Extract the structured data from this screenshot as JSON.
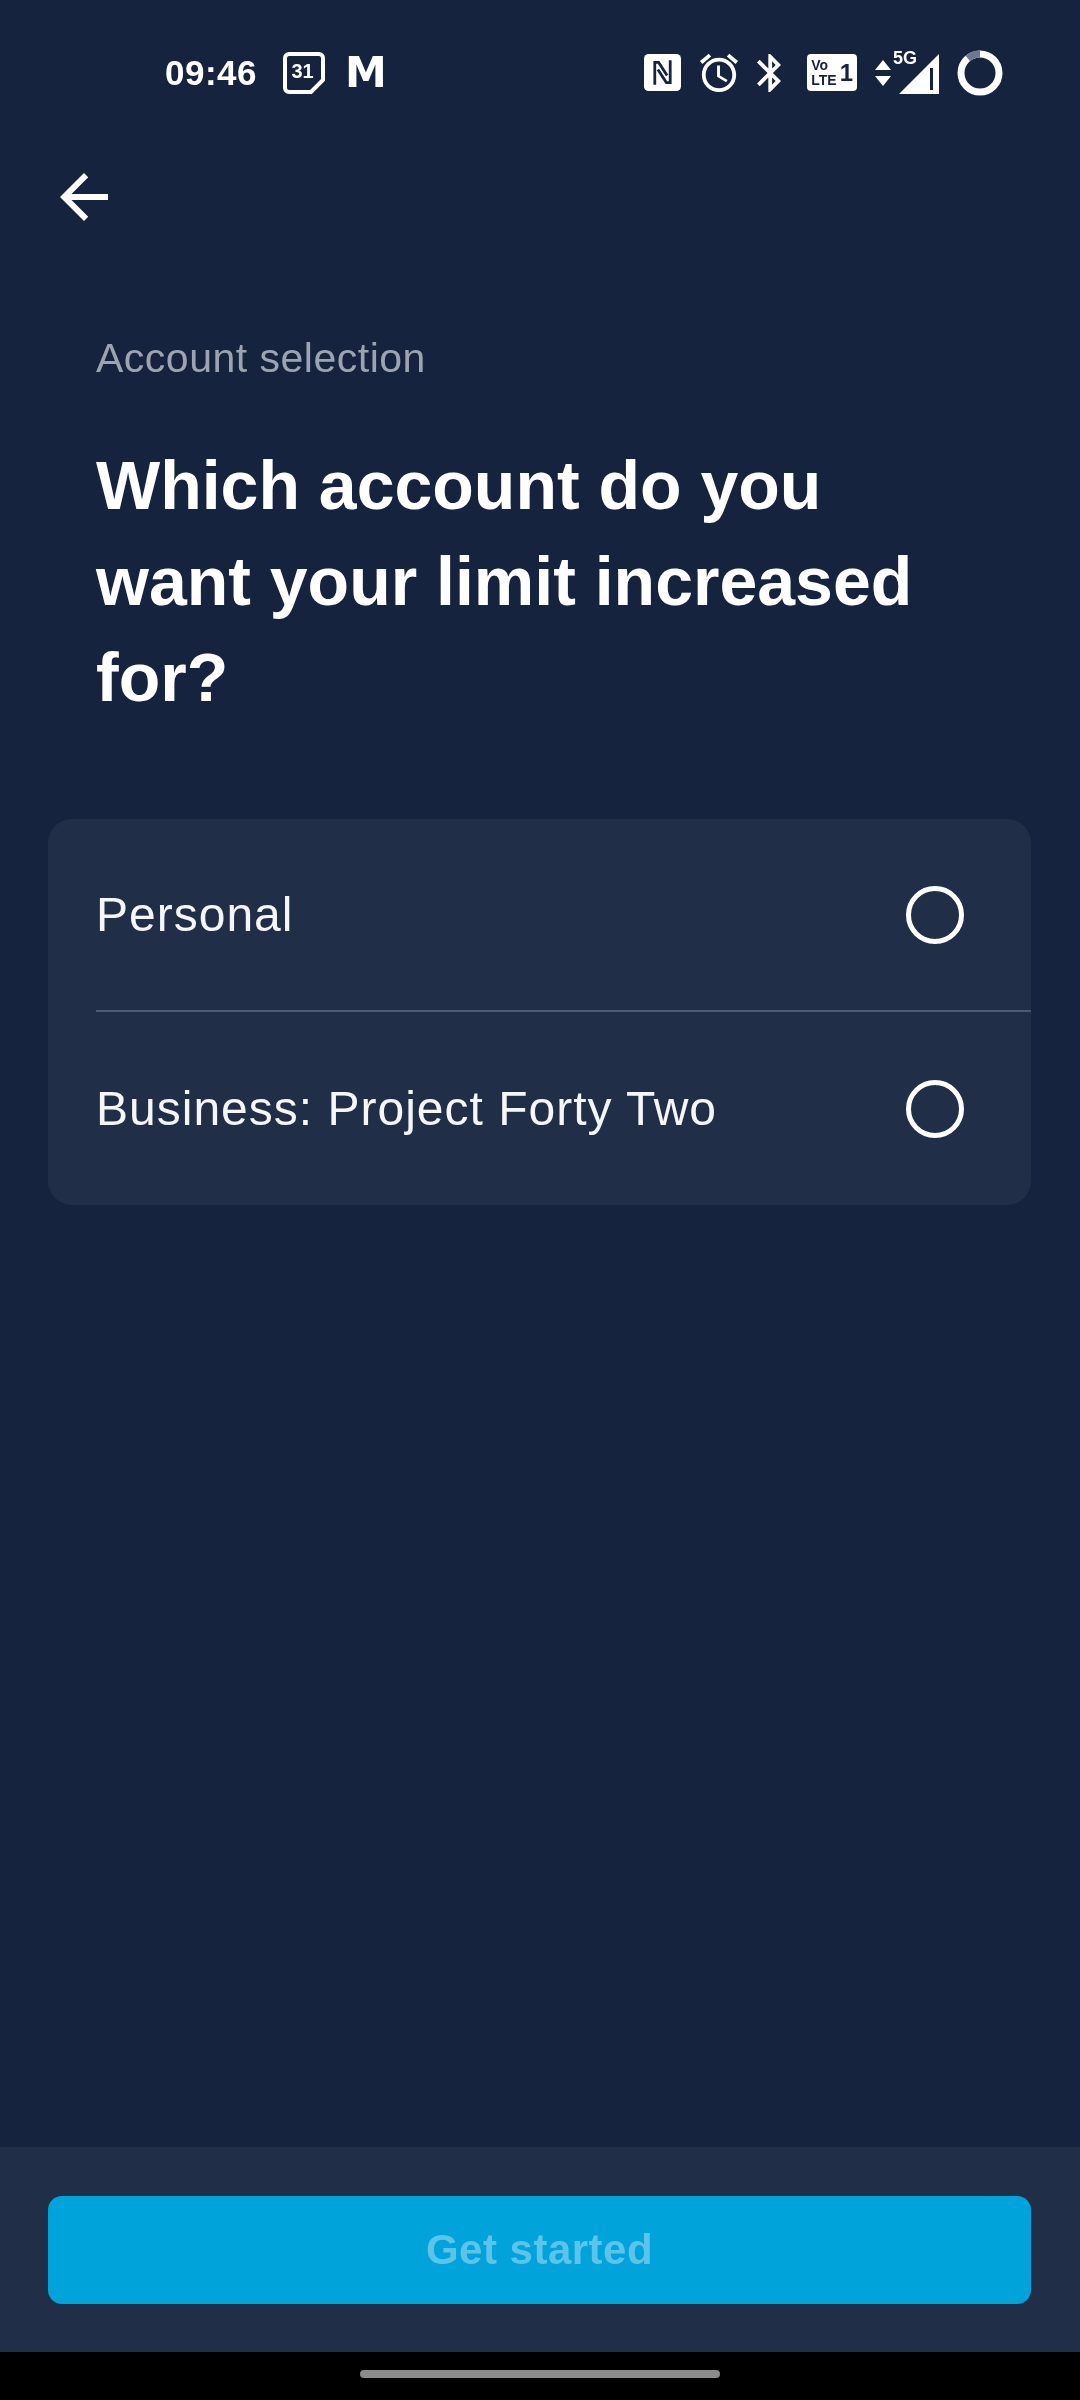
{
  "status_bar": {
    "time": "09:46",
    "calendar_day": "31",
    "app_logo": "M",
    "volte": {
      "top": "Vo",
      "bottom": "LTE",
      "sim": "1"
    },
    "network": "5G"
  },
  "header": {
    "eyebrow": "Account selection",
    "title": "Which account do you want your limit increased for?"
  },
  "accounts": [
    {
      "label": "Personal",
      "selected": false
    },
    {
      "label": "Business: Project Forty Two",
      "selected": false
    }
  ],
  "footer": {
    "button": {
      "label": "Get started",
      "disabled": true
    }
  }
}
